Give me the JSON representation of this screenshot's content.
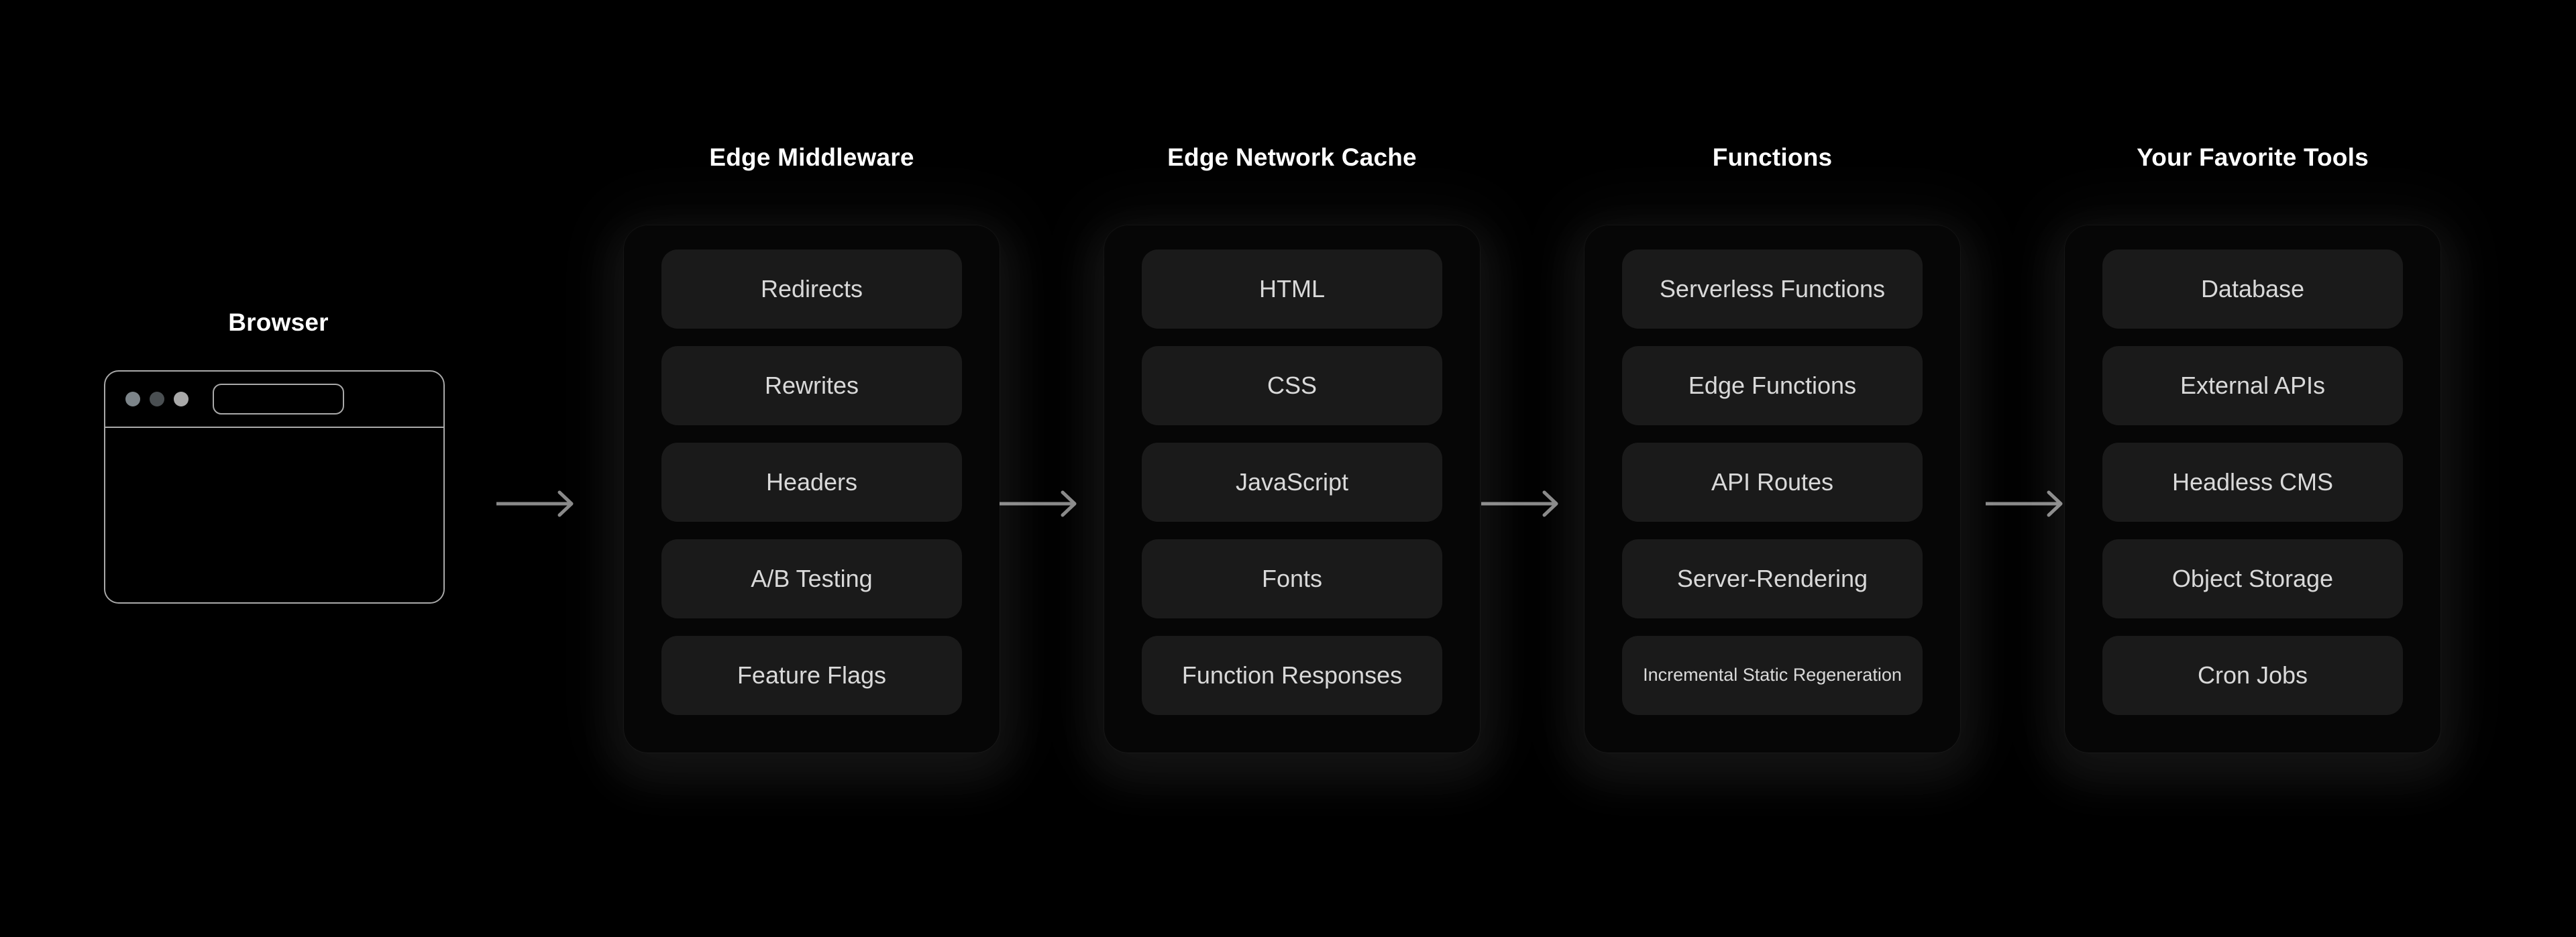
{
  "browser": {
    "title": "Browser",
    "window": {
      "dots": [
        "traffic-dot-grey",
        "traffic-dot-dark",
        "traffic-dot-light"
      ],
      "url_bar_value": ""
    }
  },
  "flow": {
    "arrows": [
      {
        "name": "arrow-browser-to-edge-middleware"
      },
      {
        "name": "arrow-edge-middleware-to-edge-network-cache"
      },
      {
        "name": "arrow-edge-network-cache-to-functions"
      },
      {
        "name": "arrow-functions-to-your-favorite-tools"
      }
    ]
  },
  "columns": [
    {
      "title": "Edge Middleware",
      "items": [
        {
          "label": "Redirects",
          "two_line": false
        },
        {
          "label": "Rewrites",
          "two_line": false
        },
        {
          "label": "Headers",
          "two_line": false
        },
        {
          "label": "A/B Testing",
          "two_line": false
        },
        {
          "label": "Feature Flags",
          "two_line": false
        }
      ]
    },
    {
      "title": "Edge Network Cache",
      "items": [
        {
          "label": "HTML",
          "two_line": false
        },
        {
          "label": "CSS",
          "two_line": false
        },
        {
          "label": "JavaScript",
          "two_line": false
        },
        {
          "label": "Fonts",
          "two_line": false
        },
        {
          "label": "Function Responses",
          "two_line": false
        }
      ]
    },
    {
      "title": "Functions",
      "items": [
        {
          "label": "Serverless Functions",
          "two_line": false
        },
        {
          "label": "Edge Functions",
          "two_line": false
        },
        {
          "label": "API Routes",
          "two_line": false
        },
        {
          "label": "Server-Rendering",
          "two_line": false
        },
        {
          "label": "Incremental Static Regeneration",
          "two_line": true
        }
      ]
    },
    {
      "title": "Your Favorite Tools",
      "items": [
        {
          "label": "Database",
          "two_line": false
        },
        {
          "label": "External APIs",
          "two_line": false
        },
        {
          "label": "Headless CMS",
          "two_line": false
        },
        {
          "label": "Object Storage",
          "two_line": false
        },
        {
          "label": "Cron Jobs",
          "two_line": false
        }
      ]
    }
  ],
  "colors": {
    "background": "#000000",
    "panel": "#060606",
    "pill": "#1a1a1a",
    "pill_text": "#d9d9d9",
    "title_text": "#ffffff",
    "arrow": "#8a8a8a",
    "browser_border": "#a9a9a9"
  }
}
